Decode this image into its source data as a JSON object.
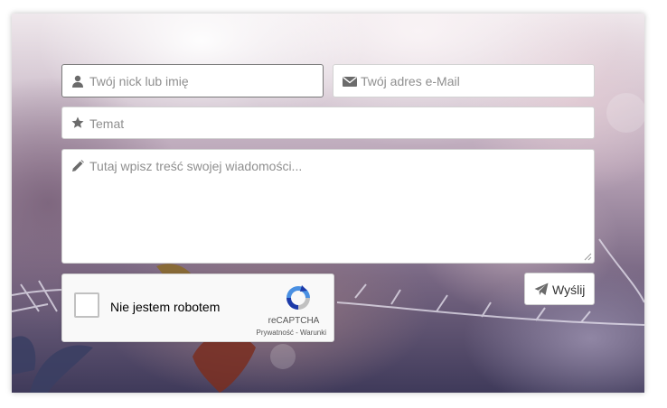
{
  "form": {
    "name_placeholder": "Twój nick lub imię",
    "email_placeholder": "Twój adres e-Mail",
    "subject_placeholder": "Temat",
    "message_placeholder": "Tutaj wpisz treść swojej wiadomości...",
    "send_label": "Wyślij"
  },
  "captcha": {
    "label": "Nie jestem robotem",
    "brand": "reCAPTCHA",
    "links": "Prywatność - Warunki"
  },
  "icons": {
    "name": "user-icon",
    "email": "envelope-icon",
    "subject": "star-icon",
    "message": "pencil-icon",
    "send": "paper-plane-icon",
    "captcha_logo": "recaptcha-logo-icon"
  },
  "colors": {
    "placeholder": "#8f8f8f",
    "icon": "#6b6b6b",
    "recaptcha_blue": "#4a90e2",
    "recaptcha_dark": "#1c3aa9"
  }
}
